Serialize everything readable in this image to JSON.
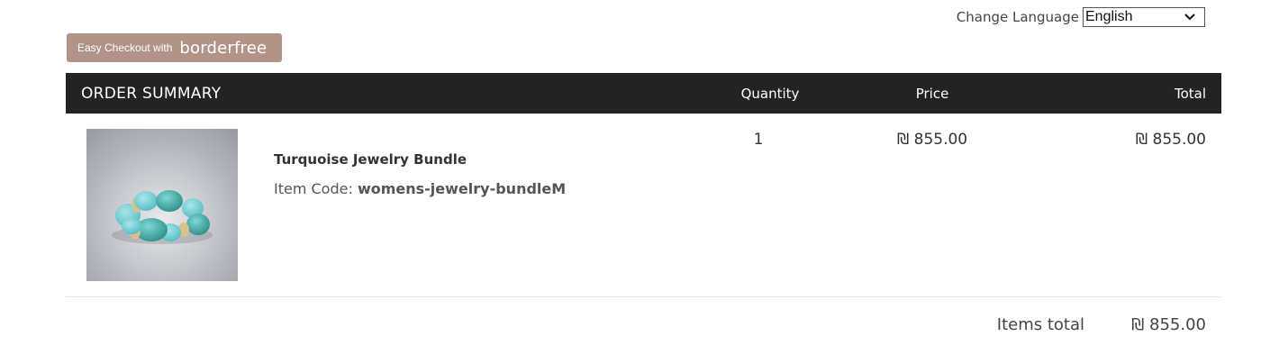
{
  "language": {
    "label": "Change Language",
    "selected": "English"
  },
  "checkout_button": {
    "prefix": "Easy Checkout with",
    "brand": "borderfree"
  },
  "order_summary": {
    "title": "ORDER SUMMARY",
    "columns": {
      "quantity": "Quantity",
      "price": "Price",
      "total": "Total"
    },
    "items": [
      {
        "name": "Turquoise Jewelry Bundle",
        "code_label": "Item Code:",
        "code": "womens-jewelry-bundleM",
        "quantity": "1",
        "price": "₪ 855.00",
        "total": "₪ 855.00",
        "image_icon": "turquoise-bracelet-image"
      }
    ],
    "items_total_label": "Items total",
    "items_total_value": "₪ 855.00"
  },
  "colors": {
    "header_bg": "#232323",
    "button_bg": "#b19487",
    "turquoise": "#3aa9a4"
  }
}
